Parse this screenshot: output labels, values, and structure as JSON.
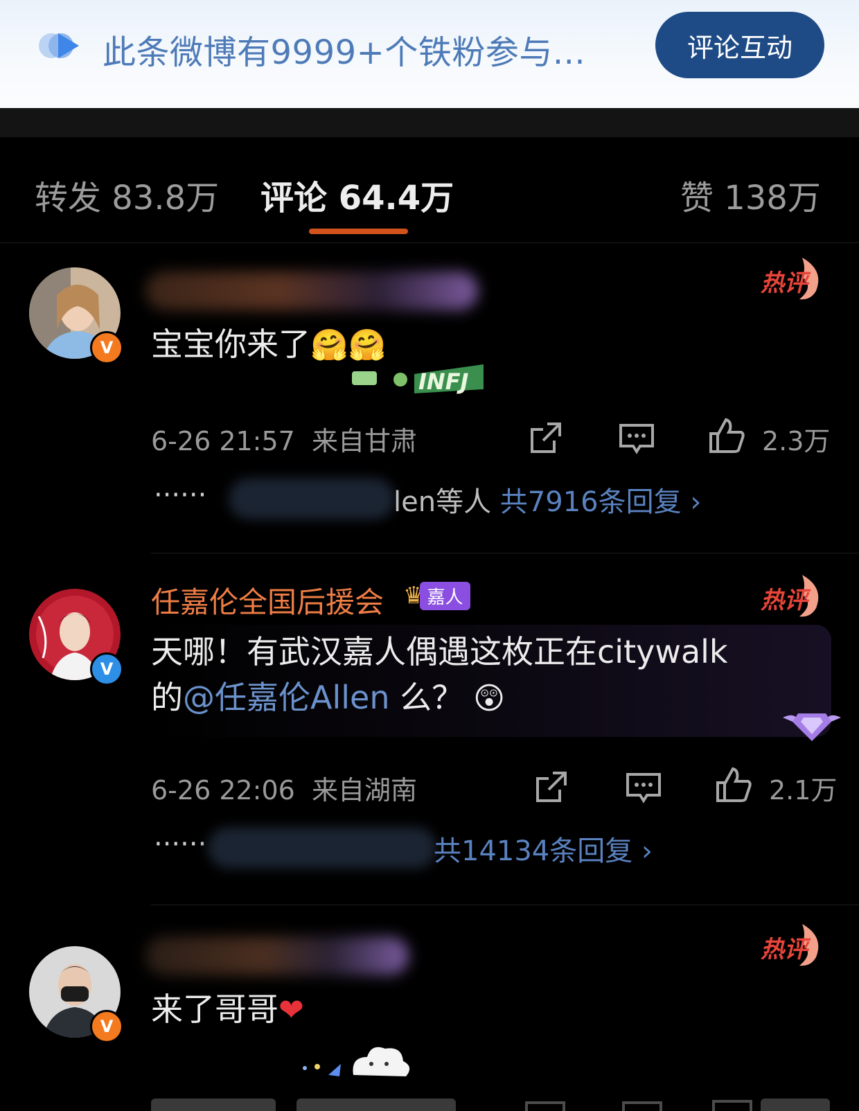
{
  "banner": {
    "text": "此条微博有9999+个铁粉参与...",
    "button_label": "评论互动"
  },
  "tabs": [
    {
      "label": "转发 83.8万"
    },
    {
      "label": "评论 64.4万"
    },
    {
      "label": "赞 138万"
    }
  ],
  "comments": [
    {
      "body": "宝宝你来了",
      "time": "6-26 21:57",
      "location": "来自甘肃",
      "likes": "2.3万",
      "reply_dots": "······",
      "reply_suffix": "len等人",
      "reply_count": "共7916条回复",
      "reply_chevron": "›",
      "sticker_text": "INFJ"
    },
    {
      "name": "任嘉伦全国后援会",
      "fan_tag": "嘉人",
      "body_line1": "天哪！有武汉嘉人偶遇这枚正在citywalk",
      "body_line2_prefix": "的",
      "mention": "@任嘉伦Allen",
      "body_line2_suffix": " 么？",
      "time": "6-26 22:06",
      "location": "来自湖南",
      "likes": "2.1万",
      "reply_dots": "······",
      "reply_count": "共14134条回复",
      "reply_chevron": "›"
    },
    {
      "body": "来了哥哥"
    }
  ],
  "colors": {
    "banner_button": "#1e4b86",
    "tab_underline": "#d2521c",
    "name_orange": "#ee7d45",
    "link_blue": "#5a82c0",
    "verified_orange": "#f47a1f",
    "verified_blue": "#2e8fe6"
  },
  "icons": [
    "share-icon",
    "comment-icon",
    "like-icon",
    "hot-comment-icon",
    "verified-icon",
    "chevron-right-icon",
    "eye-banner-icon"
  ]
}
